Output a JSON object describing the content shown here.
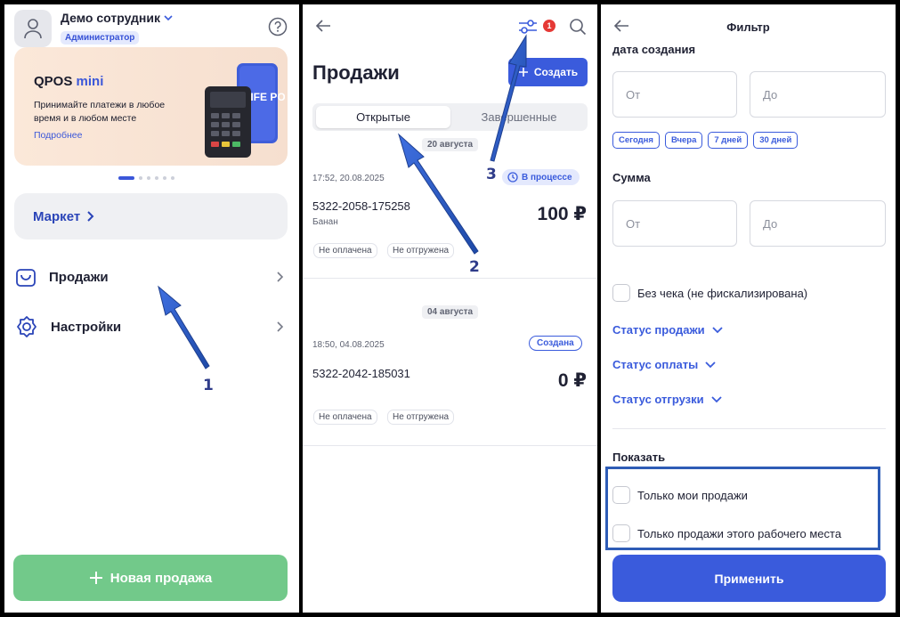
{
  "colors": {
    "accent": "#3a5bdc",
    "new_sale_green": "#72c98a",
    "badge_red": "#e53935",
    "highlight": "#2e5cb6"
  },
  "menu": {
    "user_name": "Демо сотрудник",
    "role": "Администратор",
    "banner": {
      "title": "QPOS",
      "title_accent": "mini",
      "text": "Принимайте платежи в любое время и в любом месте",
      "link": "Подробнее",
      "device_text": "LIFE POS"
    },
    "market": "Маркет",
    "items": [
      {
        "label": "Продажи",
        "icon": "bag-icon"
      },
      {
        "label": "Настройки",
        "icon": "gear-icon"
      }
    ],
    "new_sale": "Новая продажа"
  },
  "sales": {
    "title": "Продажи",
    "create": "Создать",
    "filter_badge": "1",
    "tabs": [
      "Открытые",
      "Завершенные"
    ],
    "groups": [
      {
        "date": "20 августа",
        "time": "17:52, 20.08.2025",
        "number": "5322-2058-175258",
        "customer": "Банан",
        "amount": "100 ₽",
        "status": "В процессе",
        "tags": [
          "Не оплачена",
          "Не отгружена"
        ]
      },
      {
        "date": "04 августа",
        "time": "18:50, 04.08.2025",
        "number": "5322-2042-185031",
        "customer": "",
        "amount": "0 ₽",
        "status": "Создана",
        "tags": [
          "Не оплачена",
          "Не отгружена"
        ]
      }
    ]
  },
  "filter": {
    "title": "Фильтр",
    "created_label": "дата создания",
    "from": "От",
    "to": "До",
    "quick": [
      "Сегодня",
      "Вчера",
      "7 дней",
      "30 дней"
    ],
    "sum_label": "Сумма",
    "no_receipt": "Без чека (не фискализирована)",
    "statuses": [
      "Статус продажи",
      "Статус оплаты",
      "Статус отгрузки"
    ],
    "show_label": "Показать",
    "show_options": [
      "Только мои продажи",
      "Только продажи этого рабочего места"
    ],
    "apply": "Применить"
  },
  "callouts": [
    "1",
    "2",
    "3"
  ]
}
